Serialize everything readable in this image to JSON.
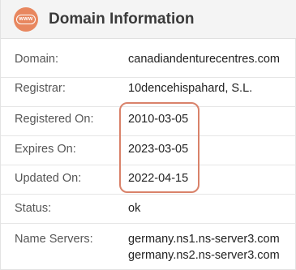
{
  "header": {
    "icon": "www-icon",
    "icon_text": "www",
    "title": "Domain Information",
    "accent_color": "#e8875f"
  },
  "rows": [
    {
      "label": "Domain:",
      "value": "canadiandenturecentres.com"
    },
    {
      "label": "Registrar:",
      "value": "10dencehispahard, S.L."
    },
    {
      "label": "Registered On:",
      "value": "2010-03-05"
    },
    {
      "label": "Expires On:",
      "value": "2023-03-05"
    },
    {
      "label": "Updated On:",
      "value": "2022-04-15"
    },
    {
      "label": "Status:",
      "value": "ok"
    },
    {
      "label": "Name Servers:",
      "values": [
        "germany.ns1.ns-server3.com",
        "germany.ns2.ns-server3.com"
      ]
    }
  ],
  "highlight_color": "#d9826a"
}
